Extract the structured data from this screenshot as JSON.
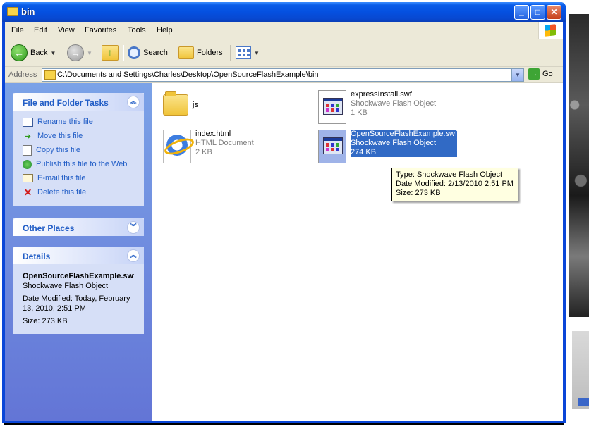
{
  "window": {
    "title": "bin",
    "controls": {
      "minimize": "_",
      "maximize": "□",
      "close": "✕"
    }
  },
  "menubar": [
    "File",
    "Edit",
    "View",
    "Favorites",
    "Tools",
    "Help"
  ],
  "toolbar": {
    "back": "Back",
    "search": "Search",
    "folders": "Folders"
  },
  "address": {
    "label": "Address",
    "path": "C:\\Documents and Settings\\Charles\\Desktop\\OpenSourceFlashExample\\bin",
    "go": "Go"
  },
  "tasks_panel": {
    "title": "File and Folder Tasks",
    "items": [
      {
        "label": "Rename this file",
        "icon": "rename-icon"
      },
      {
        "label": "Move this file",
        "icon": "move-icon"
      },
      {
        "label": "Copy this file",
        "icon": "copy-icon"
      },
      {
        "label": "Publish this file to the Web",
        "icon": "publish-icon"
      },
      {
        "label": "E-mail this file",
        "icon": "email-icon"
      },
      {
        "label": "Delete this file",
        "icon": "delete-icon"
      }
    ]
  },
  "other_places": {
    "title": "Other Places"
  },
  "details": {
    "title": "Details",
    "name": "OpenSourceFlashExample.swf",
    "type": "Shockwave Flash Object",
    "modified": "Date Modified: Today, February 13, 2010, 2:51 PM",
    "size": "Size: 273 KB"
  },
  "files": [
    {
      "name": "js",
      "type": "",
      "size": "",
      "icon": "folder-icon"
    },
    {
      "name": "expressInstall.swf",
      "type": "Shockwave Flash Object",
      "size": "1 KB",
      "icon": "swf-icon"
    },
    {
      "name": "index.html",
      "type": "HTML Document",
      "size": "2 KB",
      "icon": "ie-html-icon"
    },
    {
      "name": "OpenSourceFlashExample.swf",
      "type": "Shockwave Flash Object",
      "size": "274 KB",
      "icon": "swf-icon",
      "selected": true
    }
  ],
  "tooltip": {
    "type": "Type: Shockwave Flash Object",
    "modified": "Date Modified: 2/13/2010 2:51 PM",
    "size": "Size: 273 KB"
  }
}
